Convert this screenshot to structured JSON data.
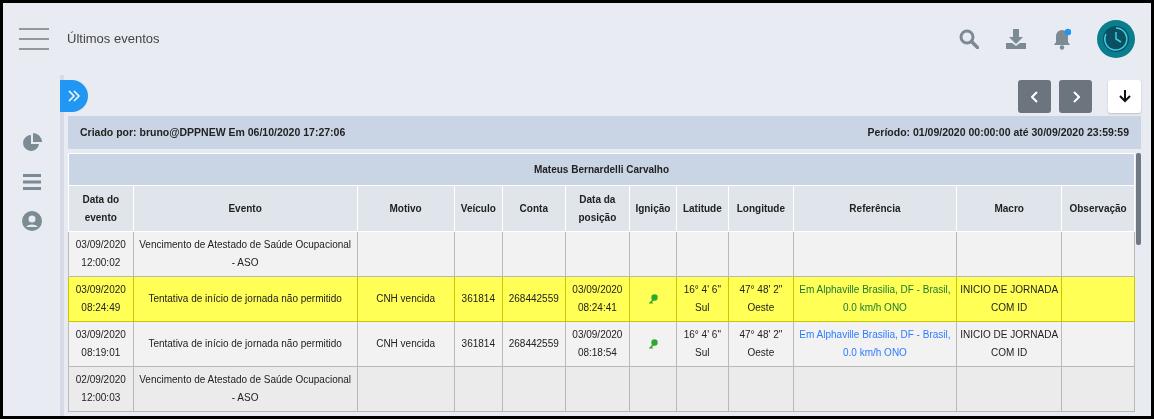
{
  "header": {
    "title": "Últimos eventos",
    "notification_unread": true
  },
  "report": {
    "created": "Criado por: bruno@DPPNEW Em 06/10/2020 17:27:06",
    "period": "Período: 01/09/2020 00:00:00 até 30/09/2020 23:59:59"
  },
  "table": {
    "group": "Mateus Bernardelli Carvalho",
    "columns": [
      "Data do evento",
      "Evento",
      "Motivo",
      "Veículo",
      "Conta",
      "Data da posição",
      "Ignição",
      "Latitude",
      "Longitude",
      "Referência",
      "Macro",
      "Observação"
    ],
    "rows": [
      {
        "selected": false,
        "ignition": false,
        "cells": [
          "03/09/2020 12:00:02",
          "Vencimento de Atestado de Saúde Ocupacional - ASO"
        ]
      },
      {
        "selected": true,
        "ignition": true,
        "cells": [
          "03/09/2020 08:24:49",
          "Tentativa de início de jornada não permitido",
          "CNH vencida",
          "361814",
          "268442559",
          "03/09/2020 08:24:41",
          "",
          "16° 4' 6\" Sul",
          "47° 48' 2\" Oeste",
          "Em Alphaville Brasilia, DF - Brasil, 0.0 km/h ONO",
          "INICIO DE JORNADA COM ID"
        ]
      },
      {
        "selected": false,
        "ignition": true,
        "cells": [
          "03/09/2020 08:19:01",
          "Tentativa de início de jornada não permitido",
          "CNH vencida",
          "361814",
          "268442559",
          "03/09/2020 08:18:54",
          "",
          "16° 4' 6\" Sul",
          "47° 48' 2\" Oeste",
          "Em Alphaville Brasilia, DF - Brasil, 0.0 km/h ONO",
          "INICIO DE JORNADA COM ID"
        ]
      },
      {
        "selected": false,
        "ignition": false,
        "cells": [
          "02/09/2020 12:00:03",
          "Vencimento de Atestado de Saúde Ocupacional - ASO"
        ]
      }
    ]
  }
}
